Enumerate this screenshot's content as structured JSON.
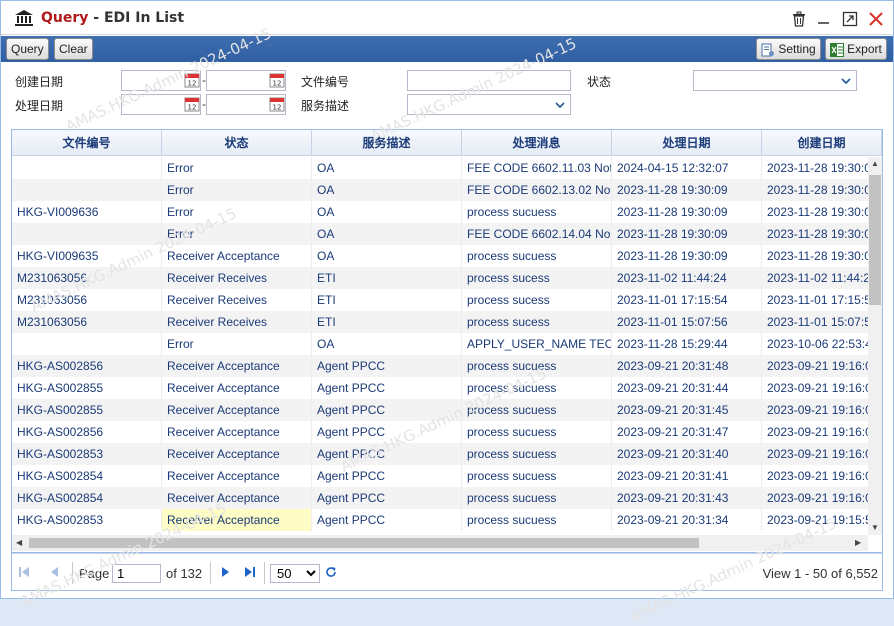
{
  "window": {
    "title_prefix": "Query",
    "title_suffix": " - EDI In List"
  },
  "toolbar": {
    "query_label": "Query",
    "clear_label": "Clear",
    "setting_label": "Setting",
    "export_label": "Export"
  },
  "filters": {
    "created_date_label": "创建日期",
    "processed_date_label": "处理日期",
    "file_no_label": "文件编号",
    "service_desc_label": "服务描述",
    "status_label": "状态",
    "created_from": "",
    "created_to": "",
    "processed_from": "",
    "processed_to": "",
    "file_no": "",
    "service_desc": "",
    "status": ""
  },
  "grid": {
    "columns": [
      "文件编号",
      "状态",
      "服务描述",
      "处理消息",
      "处理日期",
      "创建日期"
    ],
    "rows": [
      [
        "",
        "Error",
        "OA",
        "FEE CODE 6602.11.03 Not",
        "2024-04-15 12:32:07",
        "2023-11-28 19:30:0"
      ],
      [
        "",
        "Error",
        "OA",
        "FEE CODE 6602.13.02 No",
        "2023-11-28 19:30:09",
        "2023-11-28 19:30:0"
      ],
      [
        "HKG-VI009636",
        "Error",
        "OA",
        "process sucuess",
        "2023-11-28 19:30:09",
        "2023-11-28 19:30:0"
      ],
      [
        "",
        "Error",
        "OA",
        "FEE CODE 6602.14.04 No",
        "2023-11-28 19:30:09",
        "2023-11-28 19:30:0"
      ],
      [
        "HKG-VI009635",
        "Receiver Acceptance",
        "OA",
        "process sucuess",
        "2023-11-28 19:30:09",
        "2023-11-28 19:30:0"
      ],
      [
        "M231063056",
        "Receiver Receives",
        "ETI",
        "process sucess",
        "2023-11-02 11:44:24",
        "2023-11-02 11:44:2"
      ],
      [
        "M231063056",
        "Receiver Receives",
        "ETI",
        "process sucess",
        "2023-11-01 17:15:54",
        "2023-11-01 17:15:5"
      ],
      [
        "M231063056",
        "Receiver Receives",
        "ETI",
        "process sucess",
        "2023-11-01 15:07:56",
        "2023-11-01 15:07:5"
      ],
      [
        "",
        "Error",
        "OA",
        "APPLY_USER_NAME TEC",
        "2023-11-28 15:29:44",
        "2023-10-06 22:53:4"
      ],
      [
        "HKG-AS002856",
        "Receiver Acceptance",
        "Agent PPCC",
        "process sucuess",
        "2023-09-21 20:31:48",
        "2023-09-21 19:16:0"
      ],
      [
        "HKG-AS002855",
        "Receiver Acceptance",
        "Agent PPCC",
        "process sucuess",
        "2023-09-21 20:31:44",
        "2023-09-21 19:16:0"
      ],
      [
        "HKG-AS002855",
        "Receiver Acceptance",
        "Agent PPCC",
        "process sucuess",
        "2023-09-21 20:31:45",
        "2023-09-21 19:16:0"
      ],
      [
        "HKG-AS002856",
        "Receiver Acceptance",
        "Agent PPCC",
        "process sucuess",
        "2023-09-21 20:31:47",
        "2023-09-21 19:16:0"
      ],
      [
        "HKG-AS002853",
        "Receiver Acceptance",
        "Agent PPCC",
        "process sucuess",
        "2023-09-21 20:31:40",
        "2023-09-21 19:16:0"
      ],
      [
        "HKG-AS002854",
        "Receiver Acceptance",
        "Agent PPCC",
        "process sucuess",
        "2023-09-21 20:31:41",
        "2023-09-21 19:16:0"
      ],
      [
        "HKG-AS002854",
        "Receiver Acceptance",
        "Agent PPCC",
        "process sucuess",
        "2023-09-21 20:31:43",
        "2023-09-21 19:16:0"
      ],
      [
        "HKG-AS002853",
        "Receiver Acceptance",
        "Agent PPCC",
        "process sucuess",
        "2023-09-21 20:31:34",
        "2023-09-21 19:15:5"
      ]
    ],
    "selected_row": 16
  },
  "pager": {
    "page_label": "Page",
    "page_value": "1",
    "of_label": "of 132",
    "page_size": "50",
    "page_size_options": [
      "50"
    ],
    "summary": "View 1 - 50 of 6,552"
  },
  "watermark": "AMAS.HKG.Admin 2024-04-15",
  "colors": {
    "toolbar_blue": "#2f5ea3",
    "header_text": "#1a3a78",
    "title_red": "#b01818",
    "close_red": "#d9342b",
    "selected_cell": "#fdfdc5"
  },
  "icons": {
    "title": "bank-icon",
    "delete": "trash-icon",
    "minimize": "minimize-icon",
    "maximize": "maximize-icon",
    "close": "close-icon",
    "setting": "document-settings-icon",
    "export": "excel-icon",
    "calendar": "calendar-icon",
    "dropdown": "chevron-down-icon",
    "first": "first-page-icon",
    "prev": "prev-page-icon",
    "next": "next-page-icon",
    "last": "last-page-icon",
    "refresh": "refresh-icon"
  }
}
